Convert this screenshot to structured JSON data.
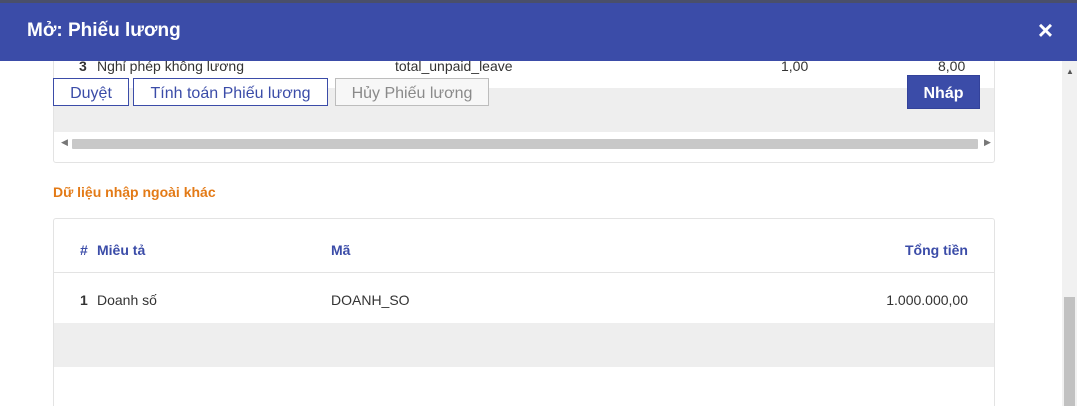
{
  "dialog": {
    "title": "Mở: Phiếu lương",
    "close_icon": "×"
  },
  "upper_table": {
    "partial_row": {
      "index": "3",
      "description": "Nghỉ phép không lương",
      "code": "total_unpaid_leave",
      "value1": "1,00",
      "value2": "8,00"
    }
  },
  "buttons": {
    "approve": "Duyệt",
    "compute": "Tính toán Phiếu lương",
    "cancel": "Hủy Phiếu lương",
    "draft": "Nháp"
  },
  "other_inputs": {
    "section_title": "Dữ liệu nhập ngoài khác",
    "columns": {
      "index": "#",
      "description": "Miêu tả",
      "code": "Mã",
      "total": "Tổng tiền"
    },
    "rows": [
      {
        "index": "1",
        "description": "Doanh số",
        "code": "DOANH_SO",
        "total": "1.000.000,00"
      }
    ]
  },
  "colors": {
    "header": "#3b4ca8",
    "accent": "#e37a16"
  }
}
